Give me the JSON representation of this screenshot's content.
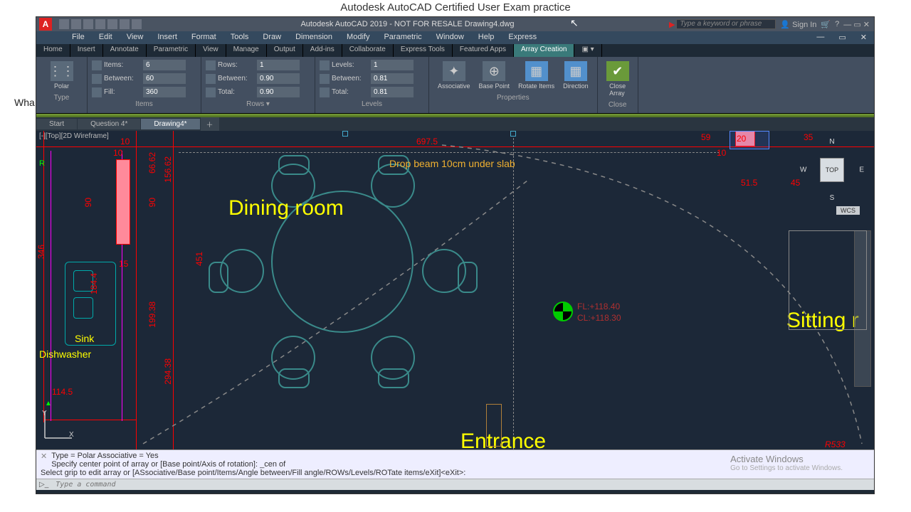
{
  "page_header": "Autodesk AutoCAD Certified User Exam practice",
  "side_text": "Wha",
  "title_bar": {
    "logo": "A",
    "center": "Autodesk AutoCAD 2019 - NOT FOR RESALE    Drawing4.dwg",
    "search_placeholder": "Type a keyword or phrase",
    "signin": "Sign In"
  },
  "menubar": [
    "File",
    "Edit",
    "View",
    "Insert",
    "Format",
    "Tools",
    "Draw",
    "Dimension",
    "Modify",
    "Parametric",
    "Window",
    "Help",
    "Express"
  ],
  "ribbon_tabs": [
    "Home",
    "Insert",
    "Annotate",
    "Parametric",
    "View",
    "Manage",
    "Output",
    "Add-ins",
    "Collaborate",
    "Express Tools",
    "Featured Apps",
    "Array Creation"
  ],
  "ribbon_tabs_active": "Array Creation",
  "ribbon": {
    "type_panel": {
      "label": "Polar",
      "title": "Type"
    },
    "items_panel": {
      "title": "Items",
      "items_label": "Items:",
      "items_val": "6",
      "between_label": "Between:",
      "between_val": "60",
      "fill_label": "Fill:",
      "fill_val": "360"
    },
    "rows_panel": {
      "title": "Rows ▾",
      "rows_label": "Rows:",
      "rows_val": "1",
      "between_label": "Between:",
      "between_val": "0.90",
      "total_label": "Total:",
      "total_val": "0.90"
    },
    "levels_panel": {
      "title": "Levels",
      "levels_label": "Levels:",
      "levels_val": "1",
      "between_label": "Between:",
      "between_val": "0.81",
      "total_label": "Total:",
      "total_val": "0.81"
    },
    "properties": {
      "title": "Properties",
      "assoc": "Associative",
      "base": "Base Point",
      "rotate": "Rotate Items",
      "direction": "Direction"
    },
    "close": {
      "title": "Close",
      "close_array": "Close\nArray"
    }
  },
  "file_tabs": {
    "tabs": [
      "Start",
      "Question 4*",
      "Drawing4*"
    ],
    "active": "Drawing4*"
  },
  "viewport": {
    "label": "[-][Top][2D Wireframe]",
    "viewcube": {
      "face": "TOP",
      "wcs": "WCS"
    },
    "dims": {
      "d_697_5": "697.5",
      "d_10a": "10",
      "d_10b": "10",
      "d_10c": "10",
      "d_66_62": "66.62",
      "d_156_62": "156.62",
      "d_90a": "90",
      "d_90b": "90",
      "d_451": "451",
      "d_199_38": "199.38",
      "d_294_38": "294.38",
      "d_346": "346",
      "d_184_4": "184.4",
      "d_15": "15",
      "d_114_5": "114.5",
      "d_59": "59",
      "d_20": "20",
      "d_35": "35",
      "d_51_5": "51.5",
      "d_45": "45",
      "r533": "R533"
    },
    "ann": {
      "drop_beam": "Drop beam 10cm under slab",
      "dining": "Dining room",
      "sitting": "Sitting r",
      "entrance": "Entrance",
      "sink": "Sink",
      "dishwasher": "Dishwasher",
      "fl": "FL:+118.40",
      "cl": "CL:+118.30"
    },
    "axes": {
      "x": "X",
      "y": "Y",
      "r": "R"
    }
  },
  "cmd": {
    "l1": "Type = Polar   Associative = Yes",
    "l2": "Specify center point of array or [Base point/Axis of rotation]: _cen of",
    "l3": "Select grip to edit array or [ASsociative/Base point/Items/Angle between/Fill angle/ROWs/Levels/ROTate items/eXit]<eXit>:",
    "input_placeholder": "Type a command"
  },
  "activate": {
    "title": "Activate Windows",
    "sub": "Go to Settings to activate Windows."
  }
}
